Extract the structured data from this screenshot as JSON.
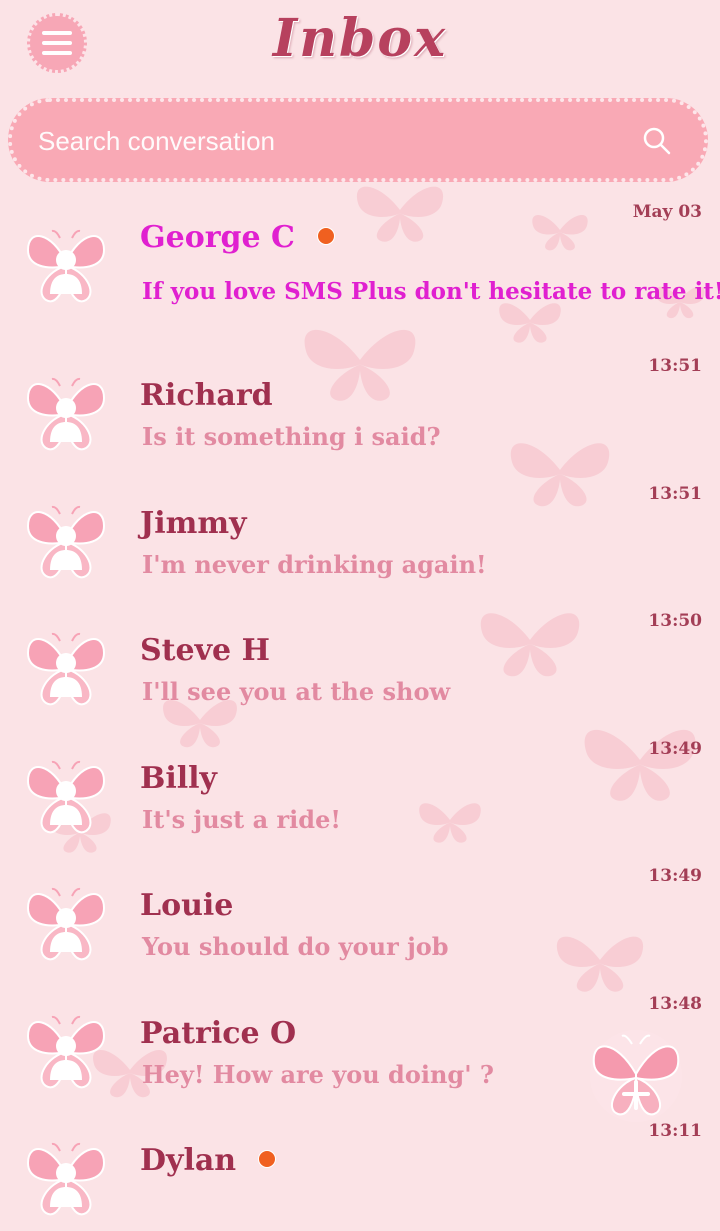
{
  "header": {
    "title": "Inbox",
    "menu_icon": "hamburger-menu-icon"
  },
  "search": {
    "placeholder": "Search conversation",
    "icon": "search-icon"
  },
  "conversations": [
    {
      "name": "George C",
      "message": "If you love SMS Plus don't hesitate to rate it!",
      "time": "May 03",
      "unread": true
    },
    {
      "name": "Richard",
      "message": "Is it something i said?",
      "time": "13:51",
      "unread": false
    },
    {
      "name": "Jimmy",
      "message": "I'm never drinking again!",
      "time": "13:51",
      "unread": false
    },
    {
      "name": "Steve H",
      "message": "I'll see you at the show",
      "time": "13:50",
      "unread": false
    },
    {
      "name": "Billy",
      "message": "It's just a ride!",
      "time": "13:49",
      "unread": false
    },
    {
      "name": "Louie",
      "message": "You should do your job",
      "time": "13:49",
      "unread": false
    },
    {
      "name": "Patrice O",
      "message": "Hey! How are you doing' ?",
      "time": "13:48",
      "unread": false
    },
    {
      "name": "Dylan",
      "message": "",
      "time": "13:11",
      "unread": true
    }
  ],
  "colors": {
    "background": "#fbe3e6",
    "accent_pink": "#f9a9b5",
    "name": "#a0304f",
    "message": "#e28aa1",
    "highlight": "#e020d0",
    "unread_dot": "#f06020"
  },
  "fab": {
    "icon": "butterfly-compose-icon"
  }
}
